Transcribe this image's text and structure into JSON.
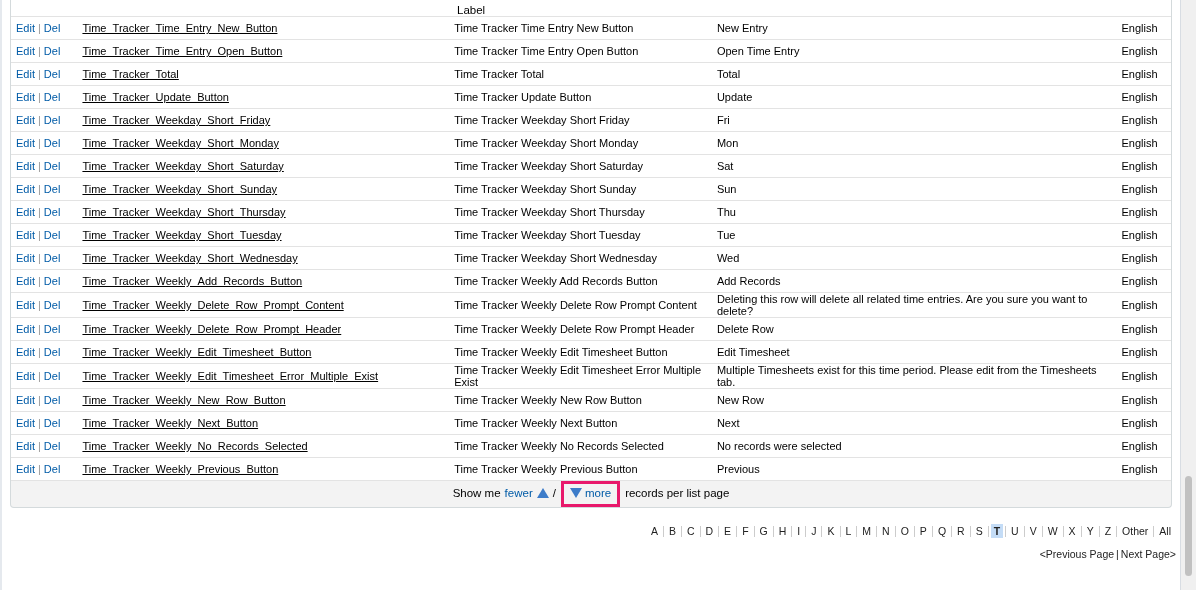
{
  "table": {
    "partial_row": {
      "label": "Label"
    },
    "rows": [
      {
        "actions": [
          "Edit",
          "Del"
        ],
        "action_separator": "|",
        "name": "Time_Tracker_Time_Entry_New_Button",
        "label": "Time Tracker Time Entry New Button",
        "text": "New Entry",
        "language": "English"
      },
      {
        "actions": [
          "Edit",
          "Del"
        ],
        "action_separator": "|",
        "name": "Time_Tracker_Time_Entry_Open_Button",
        "label": "Time Tracker Time Entry Open Button",
        "text": "Open Time Entry",
        "language": "English"
      },
      {
        "actions": [
          "Edit",
          "Del"
        ],
        "action_separator": "|",
        "name": "Time_Tracker_Total",
        "label": "Time Tracker Total",
        "text": "Total",
        "language": "English"
      },
      {
        "actions": [
          "Edit",
          "Del"
        ],
        "action_separator": "|",
        "name": "Time_Tracker_Update_Button",
        "label": "Time Tracker Update Button",
        "text": "Update",
        "language": "English"
      },
      {
        "actions": [
          "Edit",
          "Del"
        ],
        "action_separator": "|",
        "name": "Time_Tracker_Weekday_Short_Friday",
        "label": "Time Tracker Weekday Short Friday",
        "text": "Fri",
        "language": "English"
      },
      {
        "actions": [
          "Edit",
          "Del"
        ],
        "action_separator": "|",
        "name": "Time_Tracker_Weekday_Short_Monday",
        "label": "Time Tracker Weekday Short Monday",
        "text": "Mon",
        "language": "English"
      },
      {
        "actions": [
          "Edit",
          "Del"
        ],
        "action_separator": "|",
        "name": "Time_Tracker_Weekday_Short_Saturday",
        "label": "Time Tracker Weekday Short Saturday",
        "text": "Sat",
        "language": "English"
      },
      {
        "actions": [
          "Edit",
          "Del"
        ],
        "action_separator": "|",
        "name": "Time_Tracker_Weekday_Short_Sunday",
        "label": "Time Tracker Weekday Short Sunday",
        "text": "Sun",
        "language": "English"
      },
      {
        "actions": [
          "Edit",
          "Del"
        ],
        "action_separator": "|",
        "name": "Time_Tracker_Weekday_Short_Thursday",
        "label": "Time Tracker Weekday Short Thursday",
        "text": "Thu",
        "language": "English"
      },
      {
        "actions": [
          "Edit",
          "Del"
        ],
        "action_separator": "|",
        "name": "Time_Tracker_Weekday_Short_Tuesday",
        "label": "Time Tracker Weekday Short Tuesday",
        "text": "Tue",
        "language": "English"
      },
      {
        "actions": [
          "Edit",
          "Del"
        ],
        "action_separator": "|",
        "name": "Time_Tracker_Weekday_Short_Wednesday",
        "label": "Time Tracker Weekday Short Wednesday",
        "text": "Wed",
        "language": "English"
      },
      {
        "actions": [
          "Edit",
          "Del"
        ],
        "action_separator": "|",
        "name": "Time_Tracker_Weekly_Add_Records_Button",
        "label": "Time Tracker Weekly Add Records Button",
        "text": "Add Records",
        "language": "English"
      },
      {
        "actions": [
          "Edit",
          "Del"
        ],
        "action_separator": "|",
        "name": "Time_Tracker_Weekly_Delete_Row_Prompt_Content",
        "label": "Time Tracker Weekly Delete Row Prompt Content",
        "text": "Deleting this row will delete all related time entries. Are you sure you want to delete?",
        "language": "English"
      },
      {
        "actions": [
          "Edit",
          "Del"
        ],
        "action_separator": "|",
        "name": "Time_Tracker_Weekly_Delete_Row_Prompt_Header",
        "label": "Time Tracker Weekly Delete Row Prompt Header",
        "text": "Delete Row",
        "language": "English"
      },
      {
        "actions": [
          "Edit",
          "Del"
        ],
        "action_separator": "|",
        "name": "Time_Tracker_Weekly_Edit_Timesheet_Button",
        "label": "Time Tracker Weekly Edit Timesheet Button",
        "text": "Edit Timesheet",
        "language": "English"
      },
      {
        "actions": [
          "Edit",
          "Del"
        ],
        "action_separator": "|",
        "name": "Time_Tracker_Weekly_Edit_Timesheet_Error_Multiple_Exist",
        "label": "Time Tracker Weekly Edit Timesheet Error Multiple Exist",
        "text": "Multiple Timesheets exist for this time period. Please edit from the Timesheets tab.",
        "language": "English"
      },
      {
        "actions": [
          "Edit",
          "Del"
        ],
        "action_separator": "|",
        "name": "Time_Tracker_Weekly_New_Row_Button",
        "label": "Time Tracker Weekly New Row Button",
        "text": "New Row",
        "language": "English"
      },
      {
        "actions": [
          "Edit",
          "Del"
        ],
        "action_separator": "|",
        "name": "Time_Tracker_Weekly_Next_Button",
        "label": "Time Tracker Weekly Next Button",
        "text": "Next",
        "language": "English"
      },
      {
        "actions": [
          "Edit",
          "Del"
        ],
        "action_separator": "|",
        "name": "Time_Tracker_Weekly_No_Records_Selected",
        "label": "Time Tracker Weekly No Records Selected",
        "text": "No records were selected",
        "language": "English"
      },
      {
        "actions": [
          "Edit",
          "Del"
        ],
        "action_separator": "|",
        "name": "Time_Tracker_Weekly_Previous_Button",
        "label": "Time Tracker Weekly Previous Button",
        "text": "Previous",
        "language": "English"
      }
    ]
  },
  "list_size": {
    "prefix": "Show me",
    "fewer": "fewer",
    "separator": "/",
    "more": "more",
    "suffix": "records per list page",
    "more_highlighted": true
  },
  "alphabet": [
    {
      "label": "A",
      "selected": false
    },
    {
      "label": "B",
      "selected": false
    },
    {
      "label": "C",
      "selected": false
    },
    {
      "label": "D",
      "selected": false
    },
    {
      "label": "E",
      "selected": false
    },
    {
      "label": "F",
      "selected": false
    },
    {
      "label": "G",
      "selected": false
    },
    {
      "label": "H",
      "selected": false
    },
    {
      "label": "I",
      "selected": false
    },
    {
      "label": "J",
      "selected": false
    },
    {
      "label": "K",
      "selected": false
    },
    {
      "label": "L",
      "selected": false
    },
    {
      "label": "M",
      "selected": false
    },
    {
      "label": "N",
      "selected": false
    },
    {
      "label": "O",
      "selected": false
    },
    {
      "label": "P",
      "selected": false
    },
    {
      "label": "Q",
      "selected": false
    },
    {
      "label": "R",
      "selected": false
    },
    {
      "label": "S",
      "selected": false
    },
    {
      "label": "T",
      "selected": true
    },
    {
      "label": "U",
      "selected": false
    },
    {
      "label": "V",
      "selected": false
    },
    {
      "label": "W",
      "selected": false
    },
    {
      "label": "X",
      "selected": false
    },
    {
      "label": "Y",
      "selected": false
    },
    {
      "label": "Z",
      "selected": false
    },
    {
      "label": "Other",
      "selected": false
    },
    {
      "label": "All",
      "selected": false
    }
  ],
  "pager": {
    "previous": "<Previous Page",
    "separator": "|",
    "next": "Next Page>"
  }
}
